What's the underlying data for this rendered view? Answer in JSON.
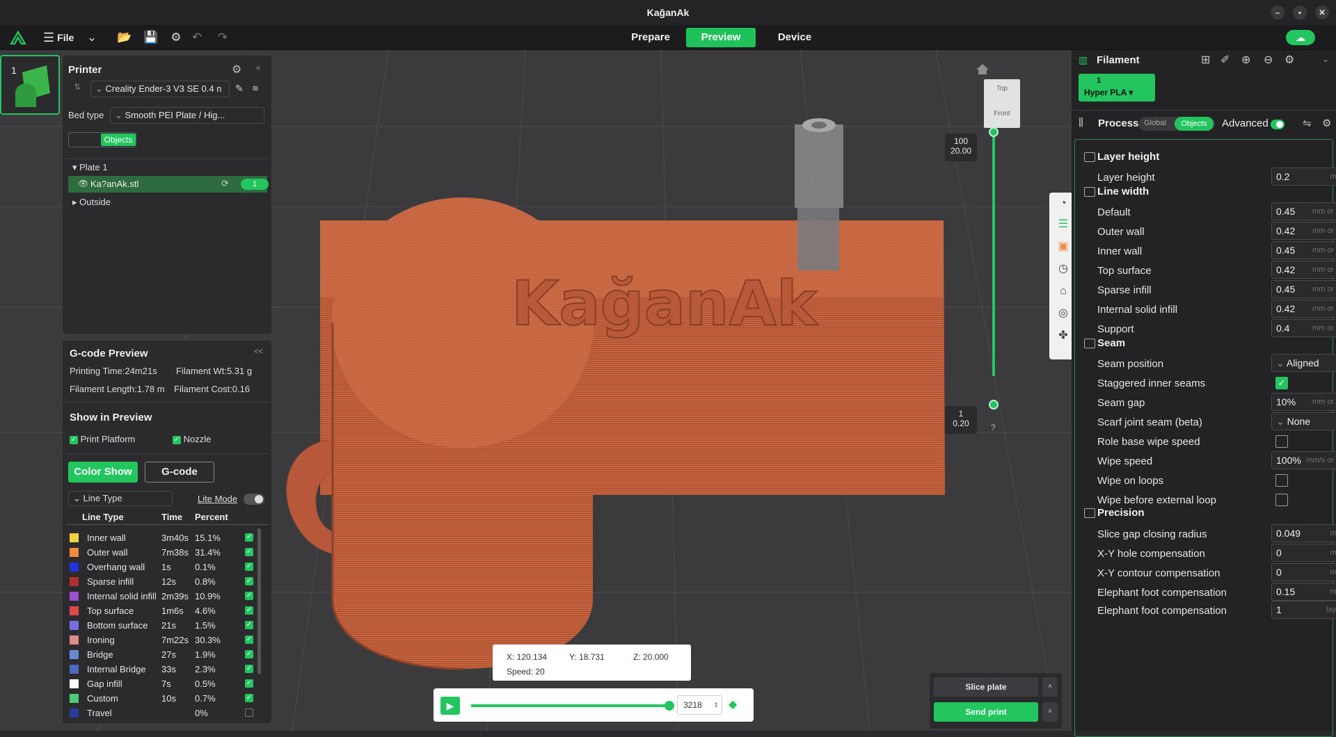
{
  "window": {
    "title": "KağanAk",
    "minimize": "–",
    "maximize": "▪",
    "close": "✕"
  },
  "menubar": {
    "file_label": "File",
    "tabs": [
      "Prepare",
      "Preview",
      "Device"
    ]
  },
  "plate_thumb": {
    "number": "1"
  },
  "printer": {
    "title": "Printer",
    "printer_name": "Creality Ender-3 V3 SE 0.4 n",
    "bed_type_label": "Bed type",
    "bed_type_value": "Smooth PEI Plate / Hig...",
    "objects_toggle": "Objects",
    "tree": {
      "plate": "Plate 1",
      "object": "Ka?anAk.stl",
      "object_badge": "1",
      "outside": "Outside"
    }
  },
  "gcode_preview": {
    "title": "G-code Preview",
    "collapse": "<<",
    "printing_time": "Printing Time:24m21s",
    "filament_wt": "Filament Wt:5.31 g",
    "filament_length": "Filament Length:1.78 m",
    "filament_cost": "Filament Cost:0.16",
    "show_title": "Show in Preview",
    "print_platform": "Print Platform",
    "nozzle": "Nozzle",
    "color_show": "Color Show",
    "gcode_btn": "G-code",
    "view_type": "Line Type",
    "lite_mode": "Lite Mode",
    "headers": [
      "Line Type",
      "Time",
      "Percent"
    ],
    "rows": [
      {
        "name": "Inner wall",
        "time": "3m40s",
        "percent": "15.1%",
        "color": "#f2d23c",
        "checked": true
      },
      {
        "name": "Outer wall",
        "time": "7m38s",
        "percent": "31.4%",
        "color": "#f08a3c",
        "checked": true
      },
      {
        "name": "Overhang wall",
        "time": "1s",
        "percent": "0.1%",
        "color": "#2233dd",
        "checked": true
      },
      {
        "name": "Sparse infill",
        "time": "12s",
        "percent": "0.8%",
        "color": "#b03030",
        "checked": true
      },
      {
        "name": "Internal solid infill",
        "time": "2m39s",
        "percent": "10.9%",
        "color": "#9b4fd1",
        "checked": true
      },
      {
        "name": "Top surface",
        "time": "1m6s",
        "percent": "4.6%",
        "color": "#e04848",
        "checked": true
      },
      {
        "name": "Bottom surface",
        "time": "21s",
        "percent": "1.5%",
        "color": "#7a6fe0",
        "checked": true
      },
      {
        "name": "Ironing",
        "time": "7m22s",
        "percent": "30.3%",
        "color": "#e08a8a",
        "checked": true
      },
      {
        "name": "Bridge",
        "time": "27s",
        "percent": "1.9%",
        "color": "#6a8ad0",
        "checked": true
      },
      {
        "name": "Internal Bridge",
        "time": "33s",
        "percent": "2.3%",
        "color": "#4a6ac0",
        "checked": true
      },
      {
        "name": "Gap infill",
        "time": "7s",
        "percent": "0.5%",
        "color": "#ffffff",
        "checked": true
      },
      {
        "name": "Custom",
        "time": "10s",
        "percent": "0.7%",
        "color": "#4ecb78",
        "checked": true
      },
      {
        "name": "Travel",
        "time": "",
        "percent": "0%",
        "color": "#2a3a9a",
        "checked": false
      }
    ]
  },
  "viewport": {
    "model_text": "KağanAk",
    "viewcube_top": "Top",
    "viewcube_front": "Front",
    "layer_top_num": "100",
    "layer_top_height": "20.00",
    "layer_bottom_num": "1",
    "layer_bottom_height": "0.20",
    "help": "?",
    "coords": {
      "x": "X: 120.134",
      "y": "Y: 18.731",
      "z": "Z: 20.000",
      "speed": "Speed: 20"
    },
    "move_value": "3218",
    "layer_progress": 1.0,
    "move_progress": 1.0,
    "slice_plate": "Slice plate",
    "send_print": "Send print"
  },
  "right": {
    "filament_title": "Filament",
    "filament_slot": "1",
    "filament_name": "Hyper PLA",
    "process_title": "Process",
    "mode_global": "Global",
    "mode_objects": "Objects",
    "advanced": "Advanced",
    "sections": {
      "layer_height": "Layer height",
      "line_width": "Line width",
      "seam": "Seam",
      "precision": "Precision"
    },
    "params": {
      "layer_height": {
        "label": "Layer height",
        "value": "0.2",
        "unit": "mm"
      },
      "default": {
        "label": "Default",
        "value": "0.45",
        "unit": "mm or %"
      },
      "outer_wall": {
        "label": "Outer wall",
        "value": "0.42",
        "unit": "mm or %"
      },
      "inner_wall": {
        "label": "Inner wall",
        "value": "0.45",
        "unit": "mm or %"
      },
      "top_surface": {
        "label": "Top surface",
        "value": "0.42",
        "unit": "mm or %"
      },
      "sparse_infill": {
        "label": "Sparse infill",
        "value": "0.45",
        "unit": "mm or %"
      },
      "internal_solid_infill": {
        "label": "Internal solid infill",
        "value": "0.42",
        "unit": "mm or %"
      },
      "support": {
        "label": "Support",
        "value": "0.4",
        "unit": "mm or %"
      },
      "seam_position": {
        "label": "Seam position",
        "value": "Aligned"
      },
      "staggered": {
        "label": "Staggered inner seams",
        "checked": true
      },
      "seam_gap": {
        "label": "Seam gap",
        "value": "10%",
        "unit": "mm or %"
      },
      "scarf": {
        "label": "Scarf joint seam (beta)",
        "value": "None"
      },
      "role_wipe": {
        "label": "Role base wipe speed",
        "checked": false
      },
      "wipe_speed": {
        "label": "Wipe speed",
        "value": "100%",
        "unit": "mm/s or %"
      },
      "wipe_loops": {
        "label": "Wipe on loops",
        "checked": false
      },
      "wipe_before": {
        "label": "Wipe before external loop",
        "checked": false
      },
      "slice_gap": {
        "label": "Slice gap closing radius",
        "value": "0.049",
        "unit": "mm"
      },
      "xy_hole": {
        "label": "X-Y hole compensation",
        "value": "0",
        "unit": "mm"
      },
      "xy_contour": {
        "label": "X-Y contour compensation",
        "value": "0",
        "unit": "mm"
      },
      "elephant1": {
        "label": "Elephant foot compensation",
        "value": "0.15",
        "unit": "mm"
      },
      "elephant2": {
        "label": "Elephant foot compensation",
        "value": "1",
        "unit": "layer"
      }
    }
  },
  "colors": {
    "accent": "#22c55e",
    "model": "#c4623f",
    "panel": "#2b2b2e"
  }
}
